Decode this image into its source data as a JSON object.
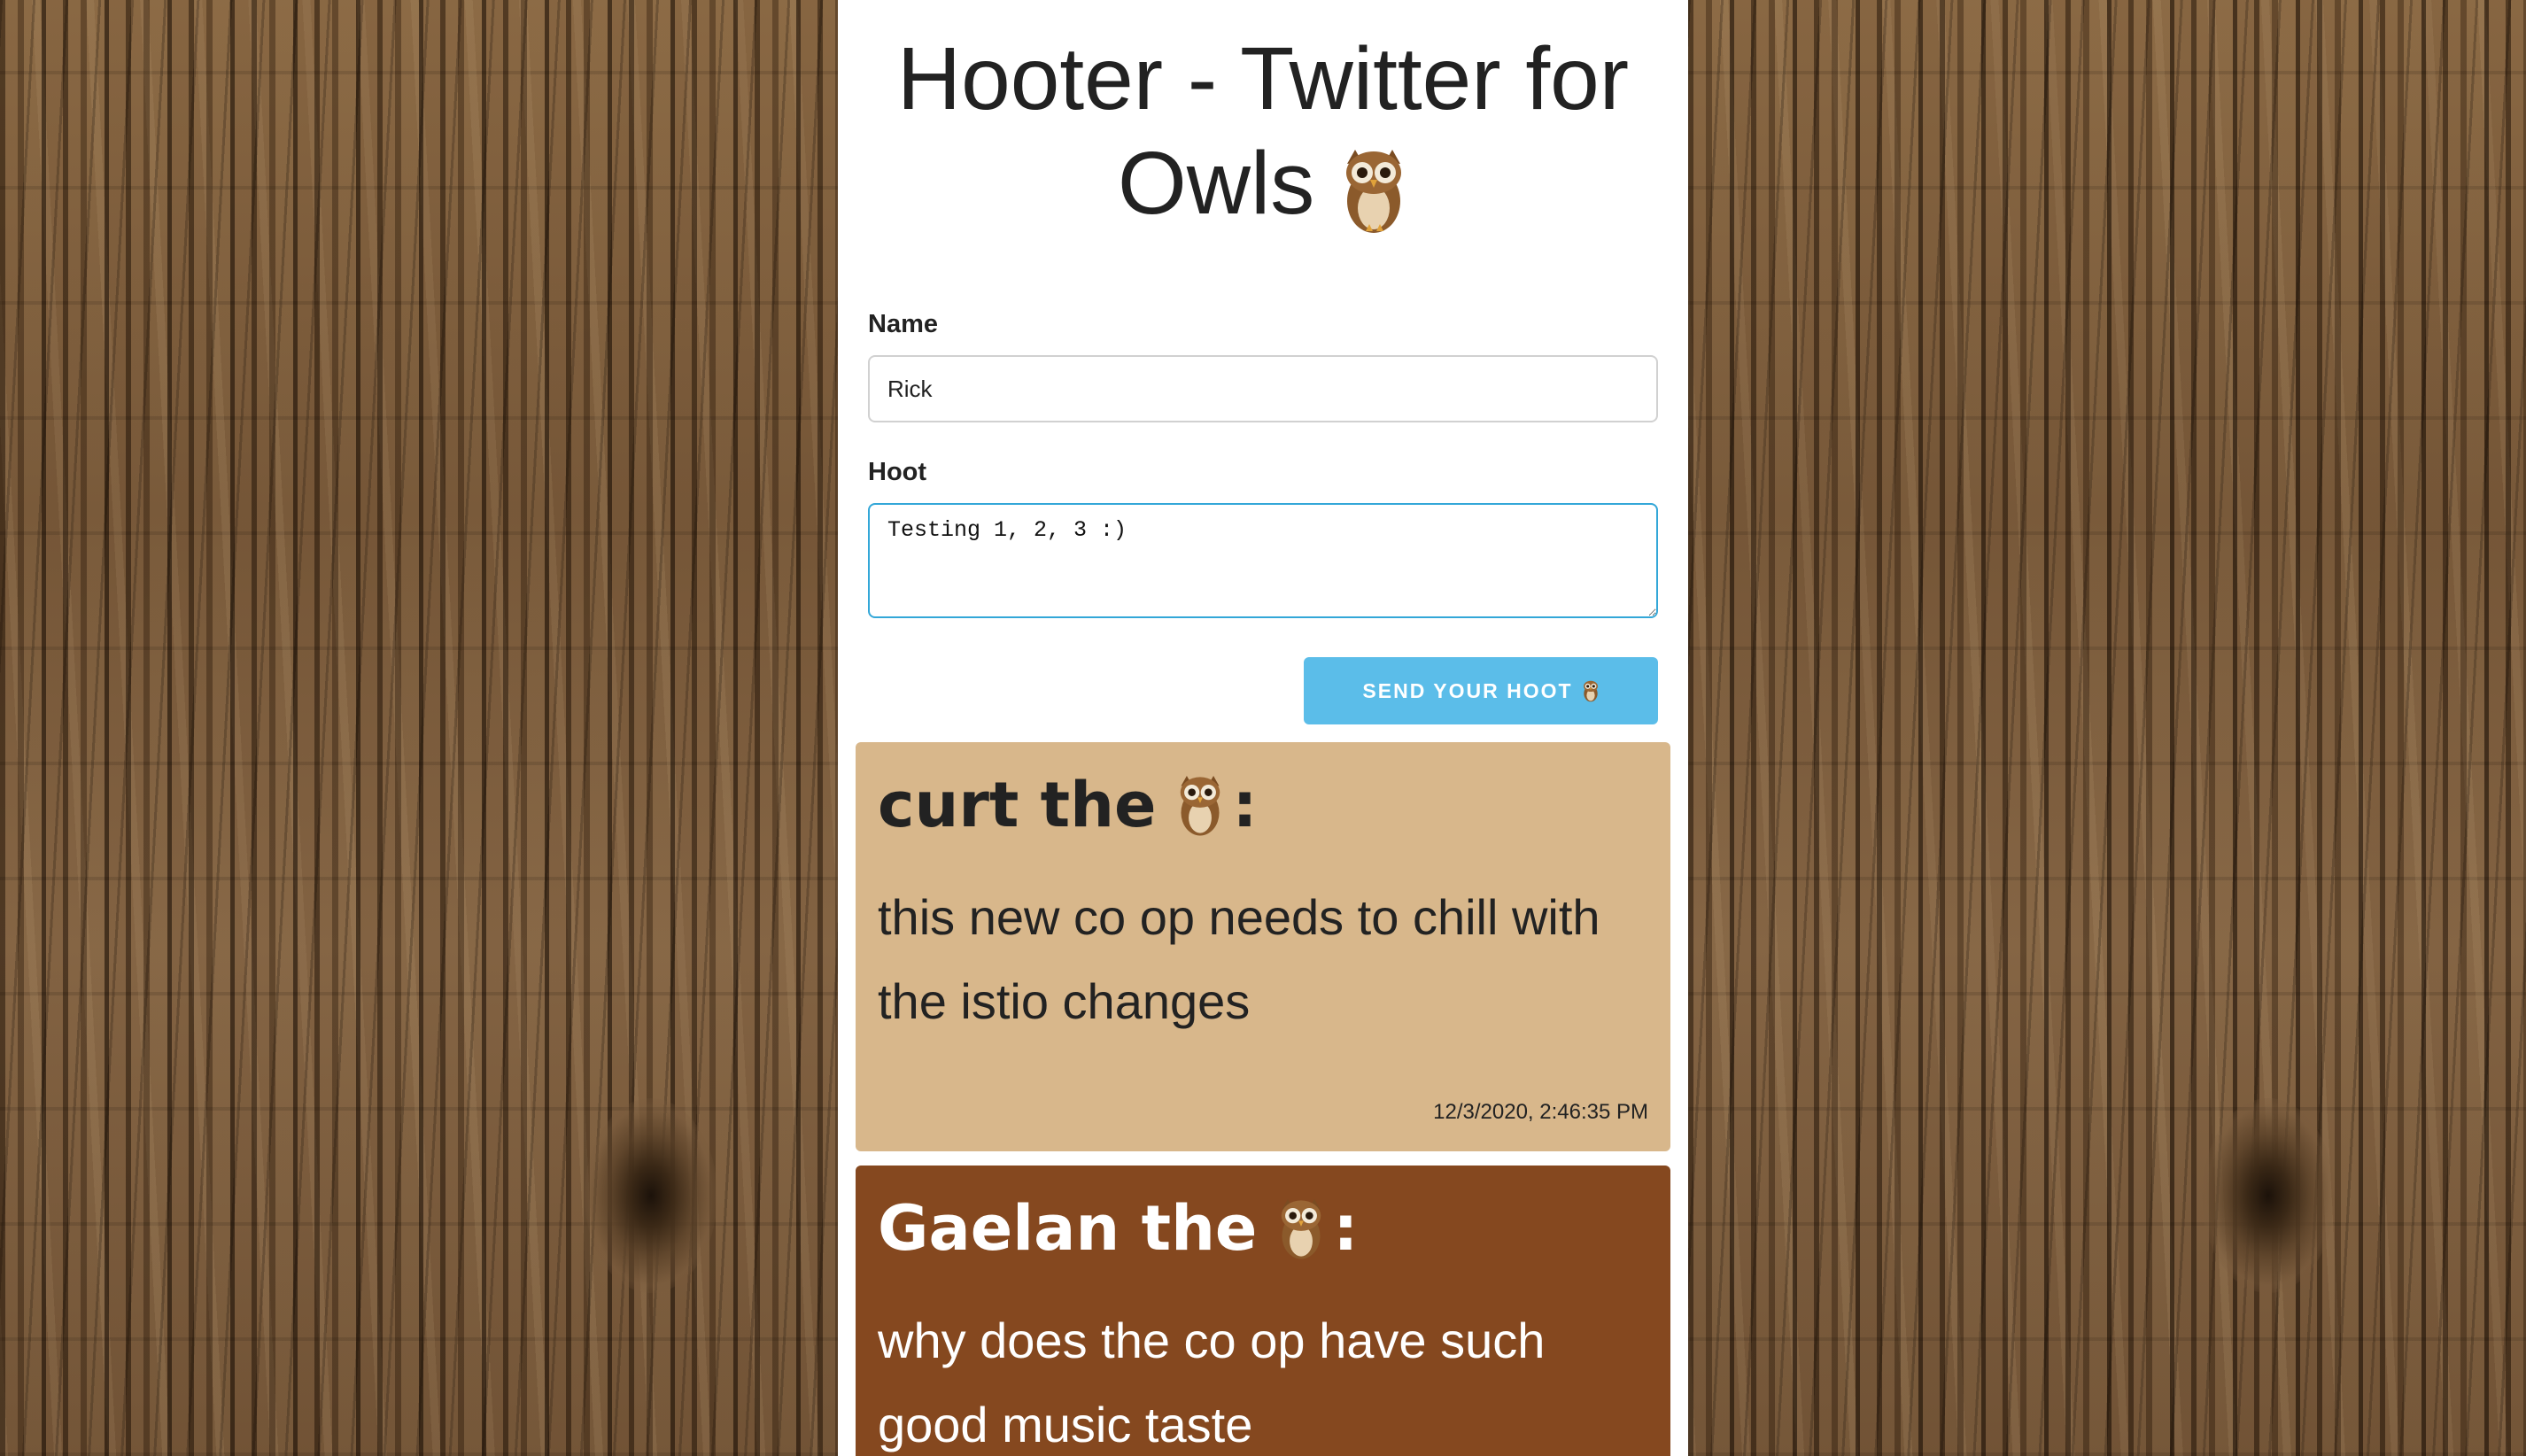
{
  "page": {
    "title": "Hooter - Twitter for Owls",
    "title_icon": "owl-icon"
  },
  "form": {
    "name_label": "Name",
    "name_value": "Rick",
    "hoot_label": "Hoot",
    "hoot_value": "Testing 1, 2, 3 :)",
    "send_label": "SEND YOUR HOOT",
    "send_icon": "owl-icon",
    "send_color": "#5bbde9",
    "focus_color": "#33a7d8"
  },
  "hoots": [
    {
      "author": "curt the",
      "author_icon": "owl-icon",
      "suffix": ":",
      "body": "this new co op needs to chill with the istio changes",
      "timestamp": "12/3/2020, 2:46:35 PM",
      "color": "#d8b78b"
    },
    {
      "author": "Gaelan the",
      "author_icon": "owl-icon",
      "suffix": ":",
      "body": "why does the co op have such good music taste",
      "color": "#85481f"
    }
  ]
}
